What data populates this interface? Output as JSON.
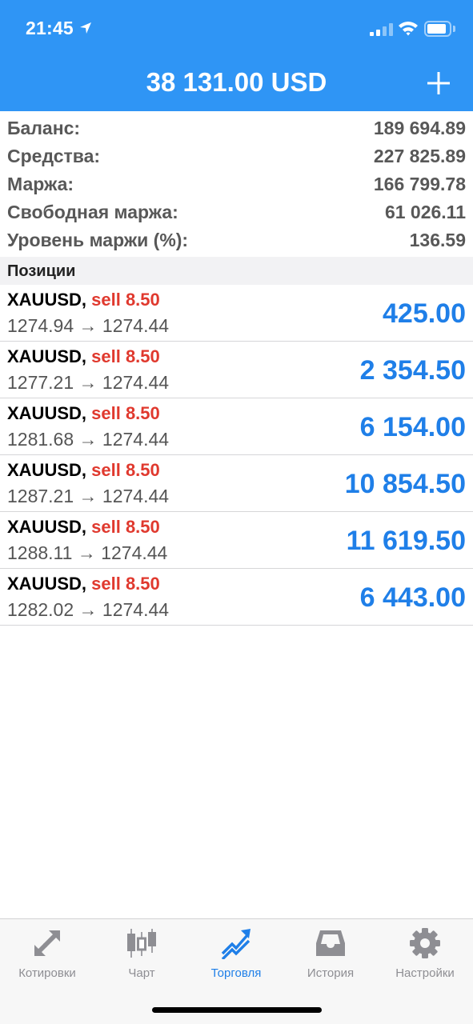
{
  "status_bar": {
    "time": "21:45"
  },
  "header": {
    "title": "38 131.00 USD",
    "add_icon": "plus-icon"
  },
  "summary": [
    {
      "label": "Баланс:",
      "value": "189 694.89"
    },
    {
      "label": "Средства:",
      "value": "227 825.89"
    },
    {
      "label": "Маржа:",
      "value": "166 799.78"
    },
    {
      "label": "Свободная маржа:",
      "value": "61 026.11"
    },
    {
      "label": "Уровень маржи (%):",
      "value": "136.59"
    }
  ],
  "positions_header": "Позиции",
  "positions": [
    {
      "symbol": "XAUUSD,",
      "side": "sell 8.50",
      "prices": "1274.94 → 1274.44",
      "profit": "425.00"
    },
    {
      "symbol": "XAUUSD,",
      "side": "sell 8.50",
      "prices": "1277.21 → 1274.44",
      "profit": "2 354.50"
    },
    {
      "symbol": "XAUUSD,",
      "side": "sell 8.50",
      "prices": "1281.68 → 1274.44",
      "profit": "6 154.00"
    },
    {
      "symbol": "XAUUSD,",
      "side": "sell 8.50",
      "prices": "1287.21 → 1274.44",
      "profit": "10 854.50"
    },
    {
      "symbol": "XAUUSD,",
      "side": "sell 8.50",
      "prices": "1288.11 → 1274.44",
      "profit": "11 619.50"
    },
    {
      "symbol": "XAUUSD,",
      "side": "sell 8.50",
      "prices": "1282.02 → 1274.44",
      "profit": "6 443.00"
    }
  ],
  "tabbar": {
    "active": "trade",
    "tabs": [
      {
        "label": "Котировки",
        "icon": "quotes-arrows-icon"
      },
      {
        "label": "Чарт",
        "icon": "candlestick-chart-icon"
      },
      {
        "label": "Торговля",
        "icon": "trade-trend-icon"
      },
      {
        "label": "История",
        "icon": "history-inbox-icon"
      },
      {
        "label": "Настройки",
        "icon": "settings-gear-icon"
      }
    ]
  },
  "colors": {
    "header_bg": "#2f95f5",
    "sell": "#e0392e",
    "profit": "#1f7fe8",
    "tab_active": "#1f7fe8",
    "tab_inactive": "#8e8e93"
  }
}
